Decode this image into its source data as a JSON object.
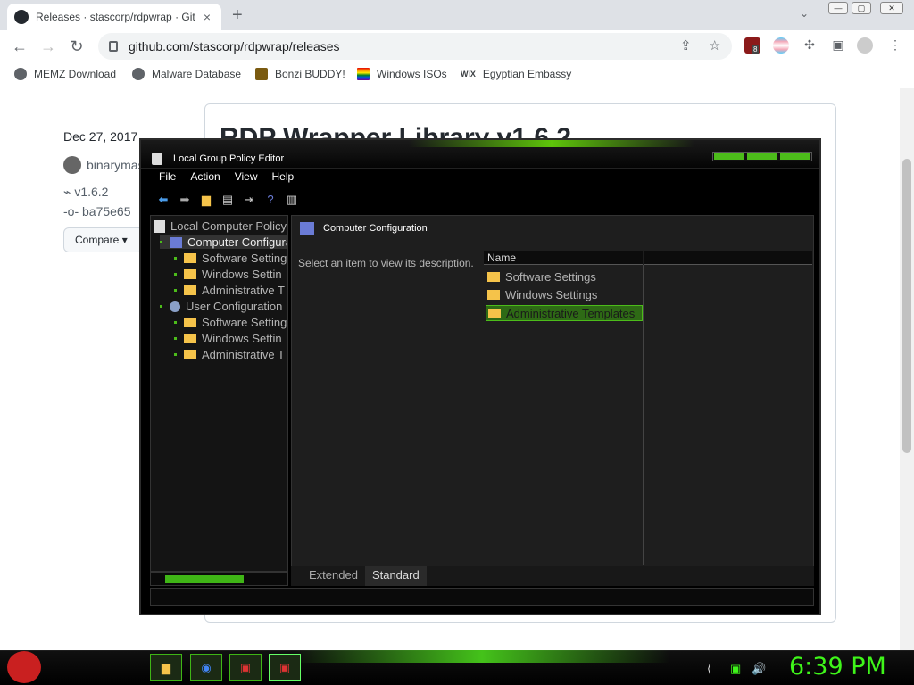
{
  "browser": {
    "tab_title": "Releases · stascorp/rdpwrap · Git",
    "url": "github.com/stascorp/rdpwrap/releases",
    "new_tab": "+",
    "tab_close": "×",
    "bookmarks": [
      "MEMZ Download",
      "Malware Database",
      "Bonzi BUDDY!",
      "Windows ISOs",
      "Egyptian Embassy"
    ],
    "extension_badge": "8"
  },
  "github": {
    "date": "Dec 27, 2017",
    "author": "binarymas",
    "tag": "v1.6.2",
    "commit": "ba75e65",
    "compare_label": "Compare",
    "release_title": "RDP Wrapper Library v1.6.2"
  },
  "gpe": {
    "title": "Local Group Policy Editor",
    "menu": [
      "File",
      "Action",
      "View",
      "Help"
    ],
    "tree": [
      {
        "label": "Local Computer Policy"
      },
      {
        "label": "Computer Configura"
      },
      {
        "label": "Software Setting"
      },
      {
        "label": "Windows Settin"
      },
      {
        "label": "Administrative T"
      },
      {
        "label": "User Configuration"
      },
      {
        "label": "Software Setting"
      },
      {
        "label": "Windows Settin"
      },
      {
        "label": "Administrative T"
      }
    ],
    "header": "Computer Configuration",
    "description": "Select an item to view its description.",
    "column_name": "Name",
    "items": [
      "Software Settings",
      "Windows Settings",
      "Administrative Templates"
    ],
    "tabs": [
      "Extended",
      "Standard"
    ],
    "active_tab": "Standard",
    "selected_item": "Administrative Templates"
  },
  "taskbar": {
    "clock": "6:39 PM",
    "accent_color": "#3ff51a"
  }
}
